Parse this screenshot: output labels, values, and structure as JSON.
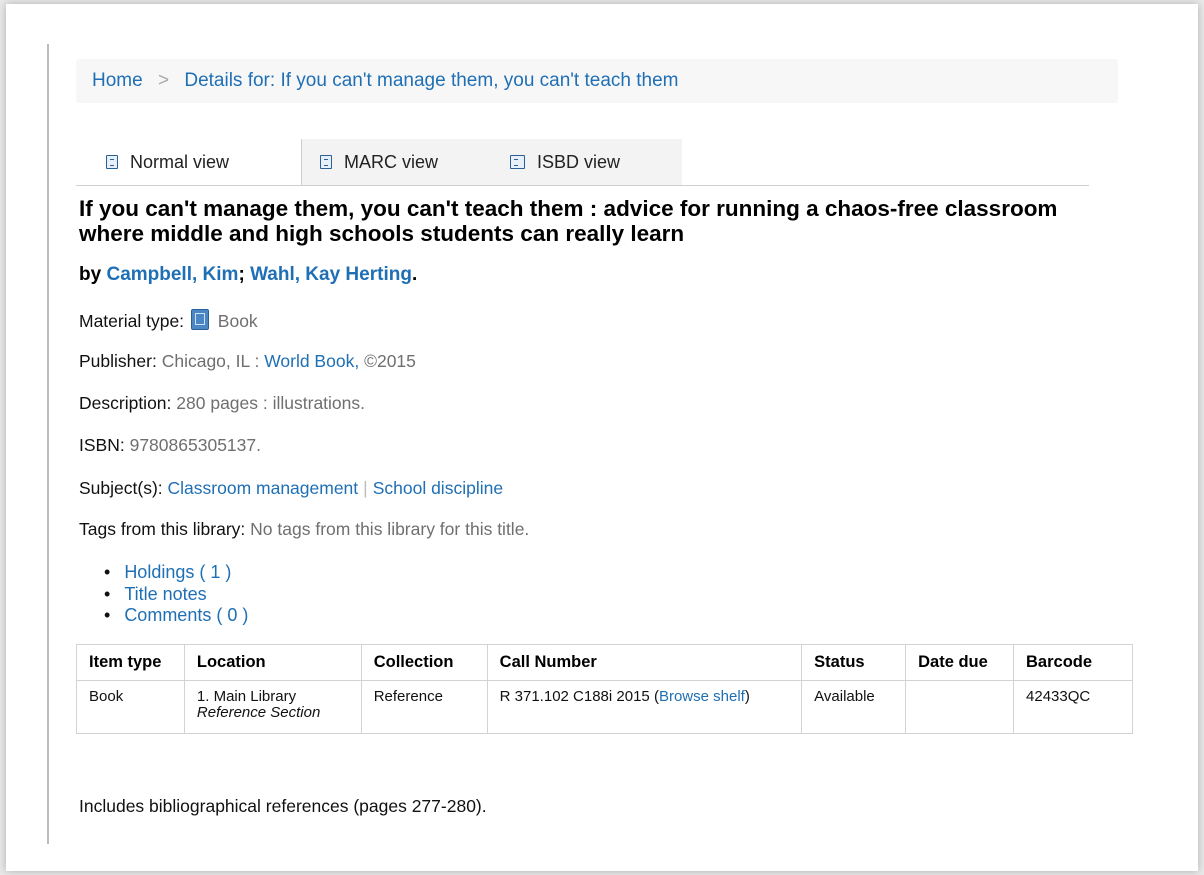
{
  "breadcrumb": {
    "home": "Home",
    "separator": ">",
    "current": "Details for: If you can't manage them, you can't teach them"
  },
  "tabs": [
    {
      "label": "Normal view"
    },
    {
      "label": "MARC view"
    },
    {
      "label": "ISBD view"
    }
  ],
  "record": {
    "title": "If you can't manage them, you can't teach them : advice for running a chaos-free classroom where middle and high schools students can really learn",
    "by_label": "by",
    "authors": [
      "Campbell, Kim",
      "Wahl, Kay Herting"
    ],
    "author_sep": ";",
    "author_end": ".",
    "material_type": {
      "label": "Material type:",
      "value": "Book",
      "icon": "book-icon"
    },
    "publisher": {
      "label": "Publisher:",
      "place": "Chicago, IL :",
      "name": "World Book,",
      "date": "©2015"
    },
    "description": {
      "label": "Description:",
      "value": "280 pages : illustrations."
    },
    "isbn": {
      "label": "ISBN:",
      "value": "9780865305137."
    },
    "subjects": {
      "label": "Subject(s):",
      "items": [
        "Classroom management",
        "School discipline"
      ],
      "sep": "|"
    },
    "tags": {
      "label": "Tags from this library:",
      "value": "No tags from this library for this title."
    }
  },
  "section_links": [
    "Holdings ( 1 )",
    "Title notes",
    "Comments ( 0 )"
  ],
  "holdings": {
    "columns": [
      "Item type",
      "Location",
      "Collection",
      "Call Number",
      "Status",
      "Date due",
      "Barcode"
    ],
    "rows": [
      {
        "item_type": "Book",
        "location": "1. Main Library",
        "location_sub": "Reference Section",
        "collection": "Reference",
        "call_number": "R 371.102 C188i 2015",
        "browse_open": "(",
        "browse_link": "Browse shelf",
        "browse_close": ")",
        "status": "Available",
        "date_due": "",
        "barcode": "42433QC"
      }
    ]
  },
  "notes": "Includes bibliographical references (pages 277-280).",
  "colors": {
    "link": "#1f6fb5",
    "muted": "#6f6f6f",
    "border": "#d3d3d3"
  }
}
